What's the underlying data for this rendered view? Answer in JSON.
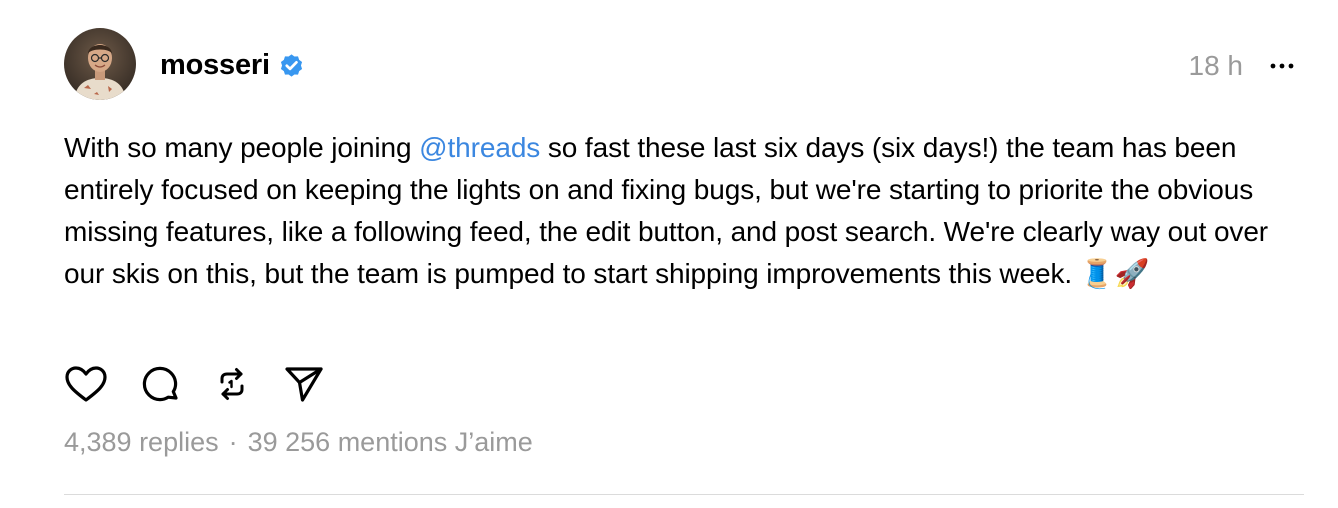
{
  "post": {
    "author": {
      "username": "mosseri",
      "verified": true,
      "avatar_icon": "profile-photo"
    },
    "timestamp": "18 h",
    "body": {
      "before_mention": "With so many people joining ",
      "mention": "@threads",
      "after_mention": " so fast these last six days (six days!) the team has been entirely focused on keeping the lights on and fixing bugs, but we're starting to priorite the obvious missing features, like a following feed, the edit button, and post search. We're clearly way out over our skis on this, but the team is pumped to start shipping improvements this week. ",
      "emojis": "🧵🚀"
    },
    "actions": [
      {
        "name": "like",
        "icon": "heart-icon"
      },
      {
        "name": "reply",
        "icon": "comment-icon"
      },
      {
        "name": "repost",
        "icon": "repost-icon"
      },
      {
        "name": "share",
        "icon": "send-icon"
      }
    ],
    "stats": {
      "replies": "4,389 replies",
      "separator": "·",
      "likes": "39 256 mentions J’aime"
    }
  },
  "colors": {
    "mention": "#3b87e0",
    "verified": "#3897f0",
    "muted": "#9a9a9a",
    "divider": "#dbdbdb"
  }
}
